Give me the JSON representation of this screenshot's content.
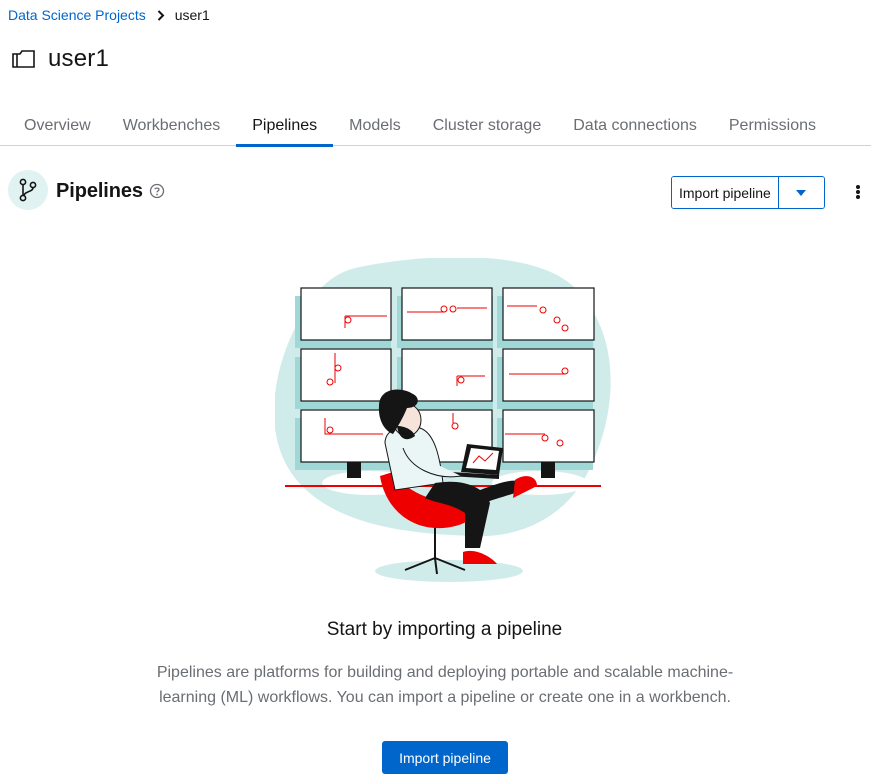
{
  "breadcrumb": {
    "parent": "Data Science Projects",
    "current": "user1"
  },
  "page": {
    "title": "user1",
    "icon": "project-folder-icon"
  },
  "tabs": [
    {
      "label": "Overview",
      "active": false
    },
    {
      "label": "Workbenches",
      "active": false
    },
    {
      "label": "Pipelines",
      "active": true
    },
    {
      "label": "Models",
      "active": false
    },
    {
      "label": "Cluster storage",
      "active": false
    },
    {
      "label": "Data connections",
      "active": false
    },
    {
      "label": "Permissions",
      "active": false
    }
  ],
  "section": {
    "title": "Pipelines",
    "icon": "pipeline-branch-icon",
    "help_icon": "help-circle-icon",
    "import_button": "Import pipeline",
    "dropdown_icon": "caret-down-icon",
    "kebab_icon": "kebab-menu-icon"
  },
  "empty_state": {
    "title": "Start by importing a pipeline",
    "body": "Pipelines are platforms for building and deploying portable and scalable machine-learning (ML) workflows. You can import a pipeline or create one in a workbench.",
    "button": "Import pipeline"
  },
  "colors": {
    "link": "#0066cc",
    "primary": "#0066cc",
    "icon_bg": "#e0f2f1",
    "illustration_blob": "#cfeceb",
    "accent_red": "#ee0000"
  }
}
